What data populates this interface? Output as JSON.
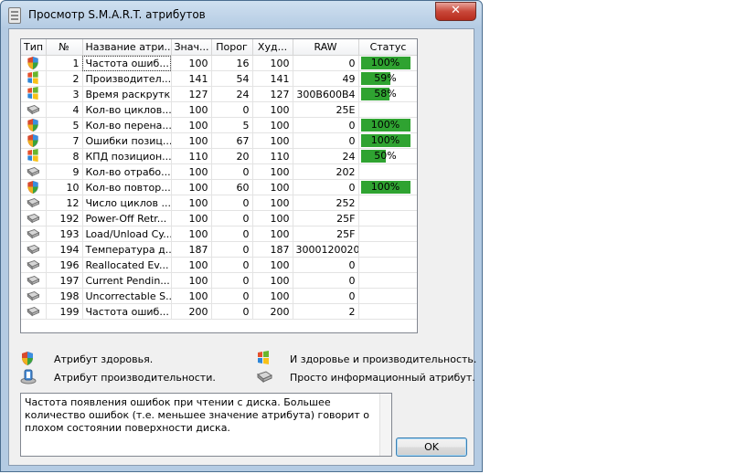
{
  "window": {
    "title": "Просмотр S.M.A.R.T. атрибутов",
    "close_label": "✕"
  },
  "columns": [
    "Тип",
    "№",
    "Название атри...",
    "Знач...",
    "Порог",
    "Худ...",
    "RAW",
    "Статус"
  ],
  "rows": [
    {
      "type": "shield-icon",
      "id": "1",
      "name": "Частота ошиб...",
      "value": "100",
      "threshold": "16",
      "worst": "100",
      "raw": "0",
      "status": "100%",
      "status_fraction": 1.0
    },
    {
      "type": "windows-flag-icon",
      "id": "2",
      "name": "Производител...",
      "value": "141",
      "threshold": "54",
      "worst": "141",
      "raw": "49",
      "status": "59%",
      "status_fraction": 0.59
    },
    {
      "type": "windows-flag-icon",
      "id": "3",
      "name": "Время раскрутки",
      "value": "127",
      "threshold": "24",
      "worst": "127",
      "raw": "300B600B4",
      "status": "58%",
      "status_fraction": 0.58
    },
    {
      "type": "disk-icon",
      "id": "4",
      "name": "Кол-во циклов...",
      "value": "100",
      "threshold": "0",
      "worst": "100",
      "raw": "25E",
      "status": "",
      "status_fraction": null
    },
    {
      "type": "shield-icon",
      "id": "5",
      "name": "Кол-во перена...",
      "value": "100",
      "threshold": "5",
      "worst": "100",
      "raw": "0",
      "status": "100%",
      "status_fraction": 1.0
    },
    {
      "type": "shield-icon",
      "id": "7",
      "name": "Ошибки позиц...",
      "value": "100",
      "threshold": "67",
      "worst": "100",
      "raw": "0",
      "status": "100%",
      "status_fraction": 1.0
    },
    {
      "type": "windows-flag-icon",
      "id": "8",
      "name": "КПД позицион...",
      "value": "110",
      "threshold": "20",
      "worst": "110",
      "raw": "24",
      "status": "50%",
      "status_fraction": 0.5
    },
    {
      "type": "disk-icon",
      "id": "9",
      "name": "Кол-во отрабо...",
      "value": "100",
      "threshold": "0",
      "worst": "100",
      "raw": "202",
      "status": "",
      "status_fraction": null
    },
    {
      "type": "shield-icon",
      "id": "10",
      "name": "Кол-во повтор...",
      "value": "100",
      "threshold": "60",
      "worst": "100",
      "raw": "0",
      "status": "100%",
      "status_fraction": 1.0
    },
    {
      "type": "disk-icon",
      "id": "12",
      "name": "Число циклов ...",
      "value": "100",
      "threshold": "0",
      "worst": "100",
      "raw": "252",
      "status": "",
      "status_fraction": null
    },
    {
      "type": "disk-icon",
      "id": "192",
      "name": "Power-Off Retr...",
      "value": "100",
      "threshold": "0",
      "worst": "100",
      "raw": "25F",
      "status": "",
      "status_fraction": null
    },
    {
      "type": "disk-icon",
      "id": "193",
      "name": "Load/Unload Cy...",
      "value": "100",
      "threshold": "0",
      "worst": "100",
      "raw": "25F",
      "status": "",
      "status_fraction": null
    },
    {
      "type": "disk-icon",
      "id": "194",
      "name": "Температура д...",
      "value": "187",
      "threshold": "0",
      "worst": "187",
      "raw": "3000120020",
      "status": "",
      "status_fraction": null
    },
    {
      "type": "disk-icon",
      "id": "196",
      "name": "Reallocated Ev...",
      "value": "100",
      "threshold": "0",
      "worst": "100",
      "raw": "0",
      "status": "",
      "status_fraction": null
    },
    {
      "type": "disk-icon",
      "id": "197",
      "name": "Current Pendin...",
      "value": "100",
      "threshold": "0",
      "worst": "100",
      "raw": "0",
      "status": "",
      "status_fraction": null
    },
    {
      "type": "disk-icon",
      "id": "198",
      "name": "Uncorrectable S...",
      "value": "100",
      "threshold": "0",
      "worst": "100",
      "raw": "0",
      "status": "",
      "status_fraction": null
    },
    {
      "type": "disk-icon",
      "id": "199",
      "name": "Частота ошиб...",
      "value": "200",
      "threshold": "0",
      "worst": "200",
      "raw": "2",
      "status": "",
      "status_fraction": null
    }
  ],
  "legend": {
    "health": "Атрибут здоровья.",
    "performance": "Атрибут производительности.",
    "both": "И здоровье и производительность.",
    "info": "Просто информационный атрибут."
  },
  "description": "Частота появления ошибок при чтении с диска. Большее количество ошибок (т.е. меньшее значение атрибута) говорит о плохом состоянии поверхности диска.",
  "ok_label": "OK",
  "colors": {
    "status_bar": "#2fa331",
    "window_frame": "#b4cbe3"
  }
}
